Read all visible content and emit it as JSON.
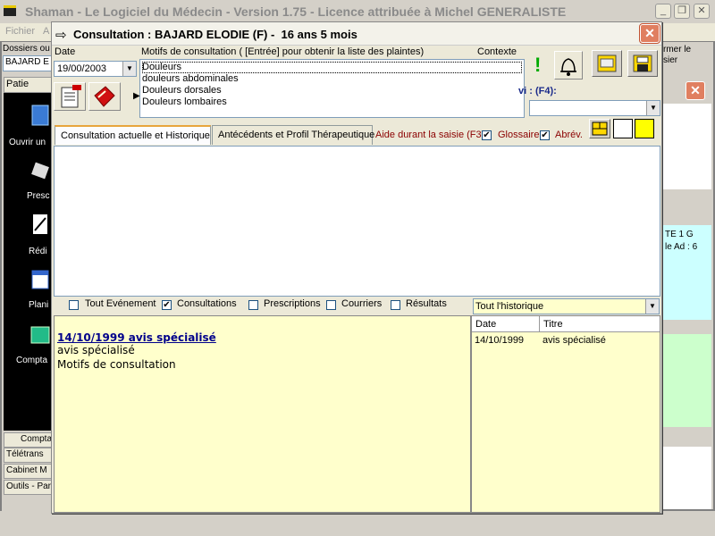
{
  "app": {
    "title": "Shaman - Le Logiciel du Médecin - Version 1.75 - Licence attribuée à Michel GENERALISTE",
    "menu": [
      "Fichier",
      "A"
    ]
  },
  "background": {
    "dossiers_label": "Dossiers ou",
    "patient_field": "BAJARD E",
    "sidebar_tab": "Patie",
    "sidebar_items": [
      "Ouvrir un",
      "Presc",
      "Rédi",
      "Plani",
      "Compta"
    ],
    "bottom_tabs": [
      "Compta",
      "Télétrans",
      "Cabinet M",
      "Outils - Par"
    ],
    "right_text": "rmer le\nsier",
    "right_cyan_text": "TE 1 G\nle Ad : 6"
  },
  "dialog": {
    "title": "Consultation : BAJARD ELODIE (F) -  16 ans 5 mois",
    "date_label": "Date",
    "date_value": "19/00/2003",
    "motifs_label": "Motifs de consultation ( [Entrée]  pour obtenir la liste des plaintes)",
    "contexte_label": "Contexte",
    "motifs": [
      "Douleurs",
      "douleurs abdominales",
      "Douleurs dorsales",
      "Douleurs lombaires"
    ],
    "suivi_label": "vi : (F4):",
    "tabs": [
      "Consultation actuelle et Historique",
      "Antécédents et Profil Thérapeutique"
    ],
    "aide_label": "Aide durant la saisie (F3):",
    "glossaire_label": "Glossaire",
    "abrev_label": "Abrév.",
    "filters": [
      "Tout Evénement",
      "Consultations",
      "Prescriptions",
      "Courriers",
      "Résultats"
    ],
    "history_select": "Tout l'historique",
    "detail": {
      "date_title": "14/10/1999 avis spécialisé",
      "line1": "avis spécialisé",
      "line2": "Motifs de consultation"
    },
    "history_table": {
      "headers": [
        "Date",
        "Titre"
      ],
      "rows": [
        [
          "14/10/1999",
          "avis spécialisé"
        ]
      ]
    }
  },
  "colors": {
    "detail_bg": "#ffffcc",
    "close_button": "#e07f60",
    "sidebar_bg": "#000000"
  }
}
